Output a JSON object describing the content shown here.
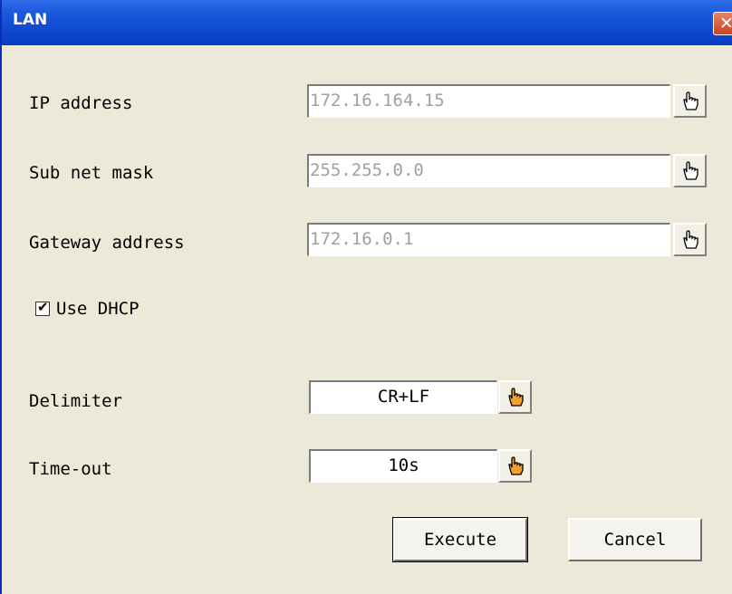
{
  "window": {
    "title": "LAN",
    "close_glyph": "✕"
  },
  "fields": {
    "ip_address": {
      "label": "IP address",
      "value": "172.16.164.15",
      "icon": "pointing-hand-icon"
    },
    "subnet_mask": {
      "label": "Sub net mask",
      "value": "255.255.0.0",
      "icon": "pointing-hand-icon"
    },
    "gateway_address": {
      "label": "Gateway address",
      "value": "172.16.0.1",
      "icon": "pointing-hand-icon"
    }
  },
  "dhcp": {
    "label": "Use DHCP",
    "checked": true,
    "check_glyph": "✔"
  },
  "delimiter": {
    "label": "Delimiter",
    "value": "CR+LF",
    "icon": "pointing-hand-icon-orange"
  },
  "timeout": {
    "label": "Time-out",
    "value": "10s",
    "icon": "pointing-hand-icon-orange"
  },
  "buttons": {
    "execute": "Execute",
    "cancel": "Cancel"
  },
  "colors": {
    "titlebar": "#0D47CF",
    "dialog_bg": "#ECE9D8",
    "disabled_text": "#A0A0A0",
    "orange_icon": "#F0A030"
  }
}
